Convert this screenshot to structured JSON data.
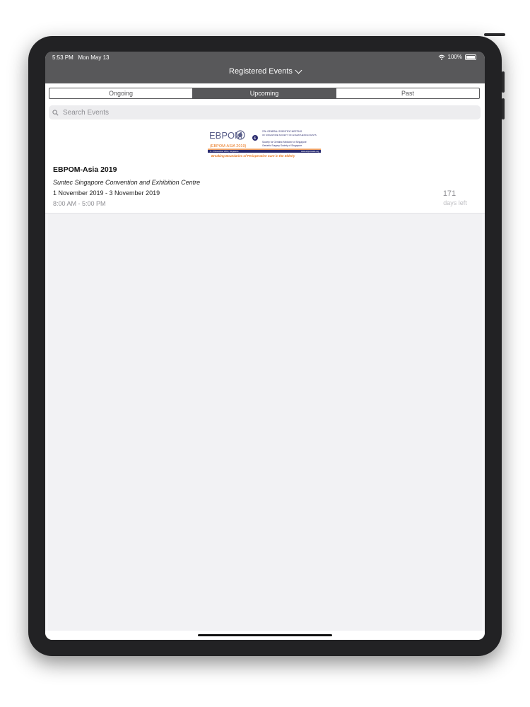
{
  "status_bar": {
    "time": "5:53 PM",
    "date": "Mon May 13",
    "battery": "100%",
    "wifi_icon": "wifi-icon",
    "battery_icon": "battery-icon"
  },
  "nav": {
    "title": "Registered Events",
    "dropdown_icon": "chevron-down-icon"
  },
  "segments": [
    {
      "label": "Ongoing",
      "active": false
    },
    {
      "label": "Upcoming",
      "active": true
    },
    {
      "label": "Past",
      "active": false
    }
  ],
  "search": {
    "placeholder": "Search Events",
    "icon": "search-icon"
  },
  "event": {
    "banner": {
      "logo_text": "EBPOM",
      "tag": "(EBPOM-ASIA 2019)",
      "amp": "&",
      "meeting_line1": "27th GENERAL SCIENTIFIC MEETING",
      "meeting_line2": "OF SINGAPORE SOCIETY OF ANAESTHESIOLOGISTS",
      "society_line1": "Society for Geriatric Medicine of Singapore",
      "society_line2": "Geriatric Surgery Society of Singapore",
      "date_strip": "1 - 3 November 2019, Singapore",
      "website": "www.ebpomasia.org",
      "tagline": "Breaking Boundaries of Perioperative Care in the Elderly"
    },
    "title": "EBPOM-Asia 2019",
    "venue": "Suntec Singapore Convention and Exhibition Centre",
    "dates": "1 November 2019 - 3 November 2019",
    "time": "8:00 AM - 5:00 PM",
    "days_left_value": "171",
    "days_left_label": "days left"
  },
  "colors": {
    "header_bg": "#58585a",
    "screen_bg": "#f2f2f4",
    "banner_orange": "#e9781f",
    "banner_navy": "#2b2c6f"
  }
}
